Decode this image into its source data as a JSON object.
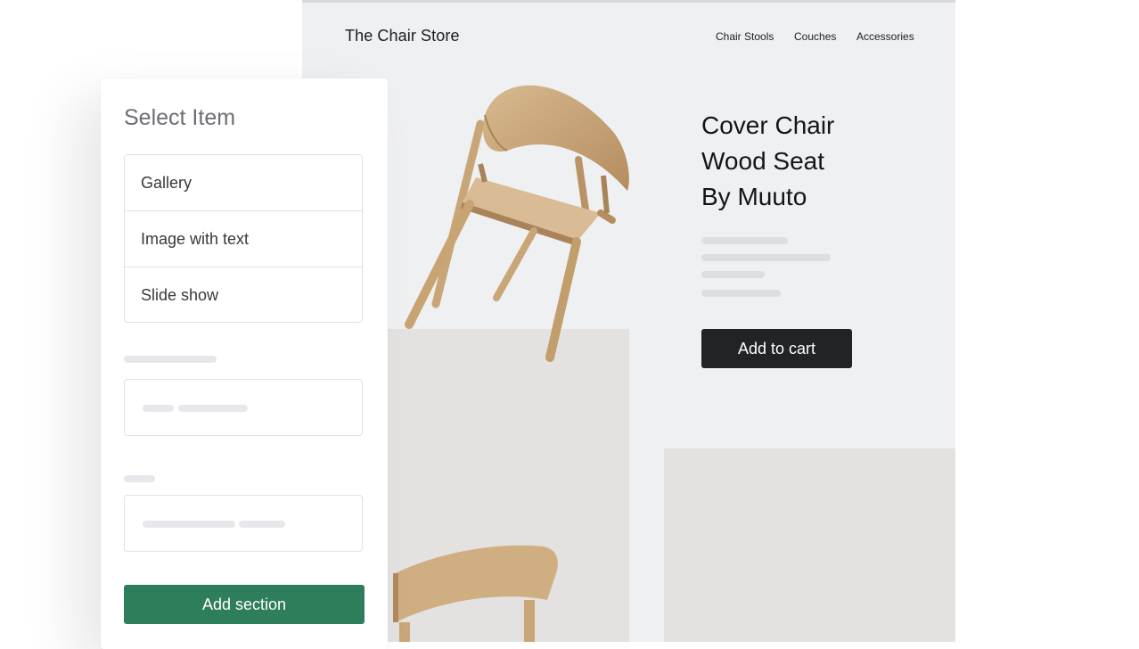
{
  "store": {
    "name": "The Chair Store",
    "nav": [
      "Chair Stools",
      "Couches",
      "Accessories"
    ],
    "product": {
      "title_lines": [
        "Cover Chair",
        "Wood Seat",
        "By Muuto"
      ],
      "cart_label": "Add to cart"
    }
  },
  "panel": {
    "title": "Select Item",
    "items": [
      "Gallery",
      "Image with text",
      "Slide show"
    ],
    "add_label": "Add section"
  },
  "colors": {
    "accent_green": "#2e7d5b",
    "cart_button": "#212326",
    "store_background": "#eff0f2"
  }
}
